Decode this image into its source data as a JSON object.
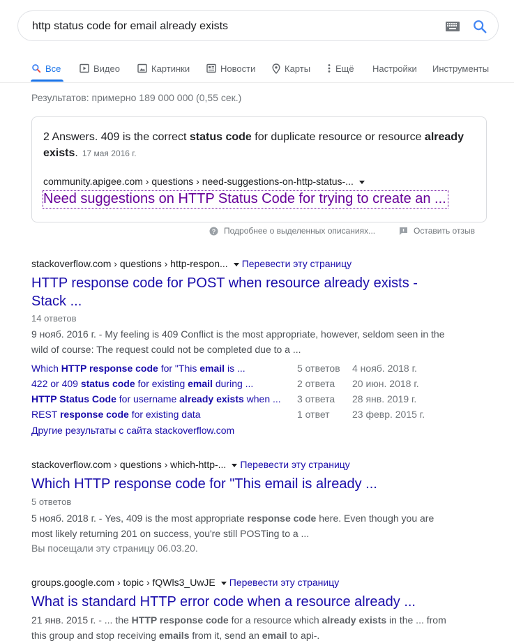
{
  "search": {
    "query": "http status code for email already exists"
  },
  "tabs": [
    {
      "label": "Все",
      "icon": "search-icon",
      "active": true
    },
    {
      "label": "Видео",
      "icon": "play-icon"
    },
    {
      "label": "Картинки",
      "icon": "image-icon"
    },
    {
      "label": "Новости",
      "icon": "news-icon"
    },
    {
      "label": "Карты",
      "icon": "map-pin-icon"
    },
    {
      "label": "Ещё",
      "icon": "more-vert-icon"
    },
    {
      "label": "Настройки"
    },
    {
      "label": "Инструменты"
    }
  ],
  "stats": "Результатов: примерно 189 000 000 (0,55 сек.)",
  "snippet": {
    "text_parts": [
      "2 Answers. 409 is the correct ",
      "status code",
      " for duplicate resource or resource ",
      "already exists",
      "."
    ],
    "date": "17 мая 2016 г.",
    "cite": "community.apigee.com › questions › need-suggestions-on-http-status-...",
    "title": "Need suggestions on HTTP Status Code for trying to create an ...",
    "about": "Подробнее о выделенных описаниях...",
    "feedback": "Оставить отзыв"
  },
  "results": [
    {
      "cite": "stackoverflow.com › questions › http-respon...",
      "translate": "Перевести эту страницу",
      "title": "HTTP response code for POST when resource already exists - Stack ...",
      "meta": "14 ответов",
      "desc": "9 нояб. 2016 г. - My feeling is 409 Conflict is the most appropriate, however, seldom seen in the wild of course: The request could not be completed due to a ...",
      "subresults": [
        {
          "parts": [
            [
              "Which ",
              false
            ],
            [
              "HTTP response code",
              true
            ],
            [
              " for \"This ",
              false
            ],
            [
              "email",
              true
            ],
            [
              " is ...",
              false
            ]
          ],
          "count": "5 ответов",
          "date": "4 нояб. 2018 г."
        },
        {
          "parts": [
            [
              "422 or 409 ",
              false
            ],
            [
              "status code",
              true
            ],
            [
              " for existing ",
              false
            ],
            [
              "email",
              true
            ],
            [
              " during ...",
              false
            ]
          ],
          "count": "2 ответа",
          "date": "20 июн. 2018 г."
        },
        {
          "parts": [
            [
              "HTTP Status Code",
              true
            ],
            [
              " for username ",
              false
            ],
            [
              "already exists",
              true
            ],
            [
              " when ...",
              false
            ]
          ],
          "count": "3 ответа",
          "date": "28 янв. 2019 г."
        },
        {
          "parts": [
            [
              "REST ",
              false
            ],
            [
              "response code",
              true
            ],
            [
              " for existing data",
              false
            ]
          ],
          "count": "1 ответ",
          "date": "23 февр. 2015 г."
        }
      ],
      "more": "Другие результаты с сайта stackoverflow.com"
    },
    {
      "cite": "stackoverflow.com › questions › which-http-...",
      "translate": "Перевести эту страницу",
      "title": "Which HTTP response code for \"This email is already ...",
      "meta": "5 ответов",
      "desc_parts": [
        [
          "5 нояб. 2018 г. - Yes, 409 is the most appropriate ",
          false
        ],
        [
          "response code",
          true
        ],
        [
          " here. Even though you are most likely returning 201 on success, you're still POSTing to a ...",
          false
        ]
      ],
      "visited": "Вы посещали эту страницу 06.03.20."
    },
    {
      "cite": "groups.google.com › topic › fQWls3_UwJE",
      "translate": "Перевести эту страницу",
      "title": "What is standard HTTP error code when a resource already ...",
      "desc_parts": [
        [
          "21 янв. 2015 г. - ... the ",
          false
        ],
        [
          "HTTP response code",
          true
        ],
        [
          " for a resource which ",
          false
        ],
        [
          "already exists",
          true
        ],
        [
          " in the ... from this group and stop receiving ",
          false
        ],
        [
          "emails",
          true
        ],
        [
          " from it, send an ",
          false
        ],
        [
          "email",
          true
        ],
        [
          " to api-.",
          false
        ]
      ]
    }
  ]
}
